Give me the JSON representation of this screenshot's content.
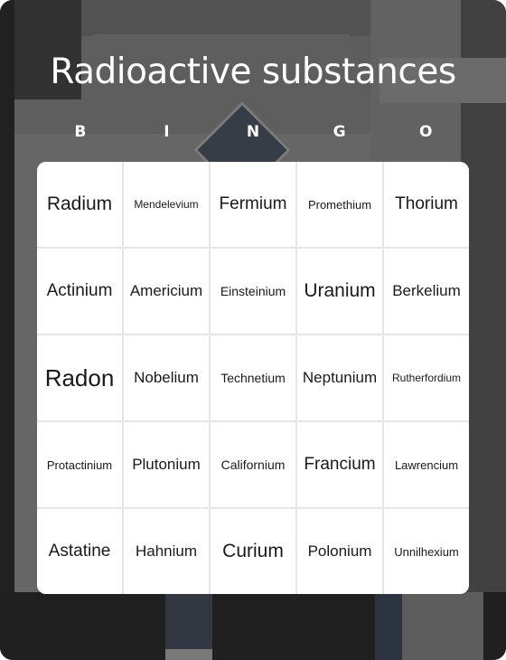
{
  "title": "Radioactive substances",
  "header_letters": [
    "B",
    "I",
    "N",
    "G",
    "O"
  ],
  "board": {
    "rows": [
      [
        {
          "text": "Radium",
          "size": "l"
        },
        {
          "text": "Mendelevium",
          "size": "xxs"
        },
        {
          "text": "Fermium",
          "size": "ml"
        },
        {
          "text": "Promethium",
          "size": "xs"
        },
        {
          "text": "Thorium",
          "size": "ml"
        }
      ],
      [
        {
          "text": "Actinium",
          "size": "ml"
        },
        {
          "text": "Americium",
          "size": "m"
        },
        {
          "text": "Einsteinium",
          "size": "s"
        },
        {
          "text": "Uranium",
          "size": "l"
        },
        {
          "text": "Berkelium",
          "size": "m"
        }
      ],
      [
        {
          "text": "Radon",
          "size": "xl"
        },
        {
          "text": "Nobelium",
          "size": "m"
        },
        {
          "text": "Technetium",
          "size": "s"
        },
        {
          "text": "Neptunium",
          "size": "m"
        },
        {
          "text": "Rutherfordium",
          "size": "xxs"
        }
      ],
      [
        {
          "text": "Protactinium",
          "size": "xs"
        },
        {
          "text": "Plutonium",
          "size": "m"
        },
        {
          "text": "Californium",
          "size": "s"
        },
        {
          "text": "Francium",
          "size": "ml"
        },
        {
          "text": "Lawrencium",
          "size": "xs"
        }
      ],
      [
        {
          "text": "Astatine",
          "size": "ml"
        },
        {
          "text": "Hahnium",
          "size": "m"
        },
        {
          "text": "Curium",
          "size": "l"
        },
        {
          "text": "Polonium",
          "size": "m"
        },
        {
          "text": "Unnilhexium",
          "size": "xs"
        }
      ]
    ]
  }
}
